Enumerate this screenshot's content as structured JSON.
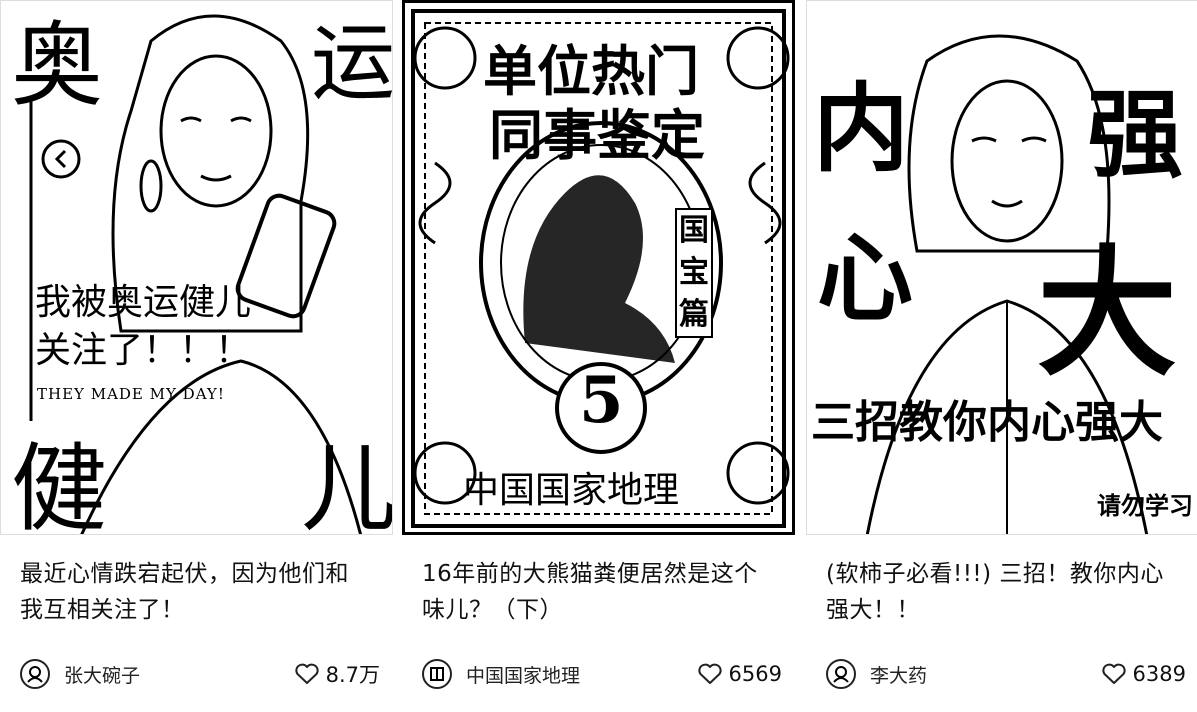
{
  "cards": [
    {
      "overlay": {
        "corner_tl": "奥",
        "corner_tr": "运",
        "corner_bl": "健",
        "corner_br": "儿",
        "line1": "我被奥运健儿",
        "line2": "关注了！！！",
        "line3": "THEY MADE MY DAY!"
      },
      "caption": "最近心情跌宕起伏，因为他们和我互相关注了！",
      "author": "张大碗子",
      "likes": "8.7万"
    },
    {
      "overlay": {
        "title1": "单位热门",
        "title2": "同事鉴定",
        "side_tag": "国宝篇",
        "number": "5",
        "footer": "中国国家地理"
      },
      "caption": "16年前的大熊猫粪便居然是这个味儿？（下）",
      "author": "中国国家地理",
      "likes": "6569"
    },
    {
      "overlay": {
        "big1": "内",
        "big2": "强",
        "big3": "心",
        "big4": "大",
        "banner": "三招教你内心强大",
        "note": "请勿学习"
      },
      "caption": "(软柿子必看!!!) 三招！教你内心强大！！",
      "author": "李大药",
      "likes": "6389"
    }
  ]
}
